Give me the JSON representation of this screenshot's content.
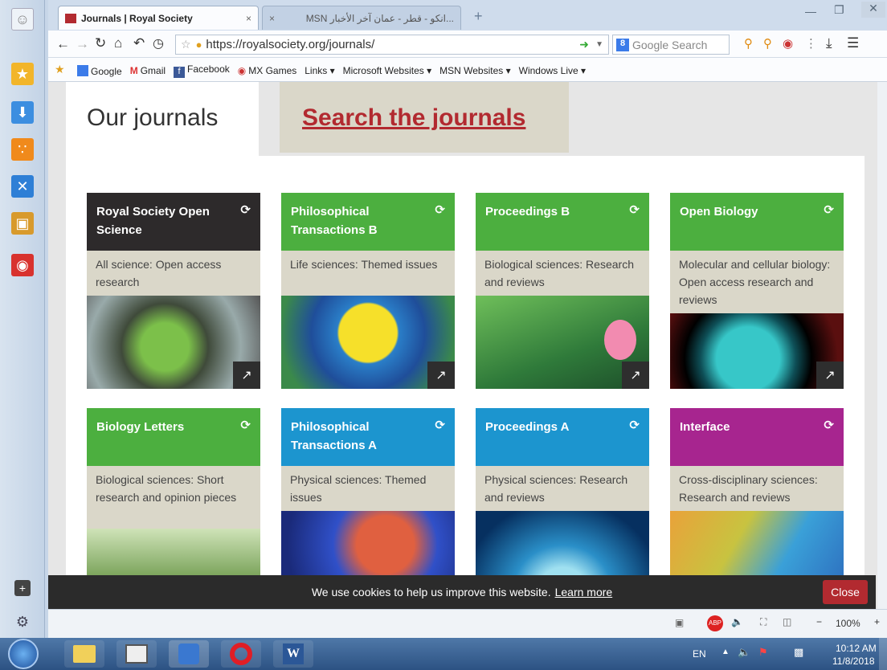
{
  "browser": {
    "tabs": [
      {
        "label": "Journals | Royal Society",
        "active": true
      },
      {
        "label": "...انكو - قطر - عمان آخر الأخبار MSN",
        "active": false
      }
    ],
    "url": "https://royalsociety.org/journals/",
    "search_placeholder": "Google Search",
    "bookmarks": [
      "Google",
      "Gmail",
      "Facebook",
      "MX Games",
      "Links",
      "Microsoft Websites",
      "MSN Websites",
      "Windows Live"
    ],
    "zoom": "100%"
  },
  "page": {
    "tab_our": "Our journals",
    "tab_search": "Search the journals",
    "journals": [
      {
        "title": "Royal Society Open Science",
        "desc": "All science: Open access research",
        "color": "#2d2a2b"
      },
      {
        "title": "Philosophical Transactions B",
        "desc": "Life sciences: Themed issues",
        "color": "#4caf3f"
      },
      {
        "title": "Proceedings B",
        "desc": "Biological sciences: Research and reviews",
        "color": "#4caf3f"
      },
      {
        "title": "Open Biology",
        "desc": "Molecular and cellular biology: Open access research and reviews",
        "color": "#4caf3f"
      },
      {
        "title": "Biology Letters",
        "desc": "Biological sciences: Short research and opinion pieces",
        "color": "#4caf3f"
      },
      {
        "title": "Philosophical Transactions A",
        "desc": "Physical sciences: Themed issues",
        "color": "#1c95cf"
      },
      {
        "title": "Proceedings A",
        "desc": "Physical sciences: Research and reviews",
        "color": "#1c95cf"
      },
      {
        "title": "Interface",
        "desc": "Cross-disciplinary sciences: Research and reviews",
        "color": "#a7258f"
      }
    ]
  },
  "cookie": {
    "text": "We use cookies to help us improve this website.",
    "link": "Learn more",
    "close": "Close"
  },
  "taskbar": {
    "lang": "EN",
    "time": "10:12 AM",
    "date": "11/8/2018"
  }
}
